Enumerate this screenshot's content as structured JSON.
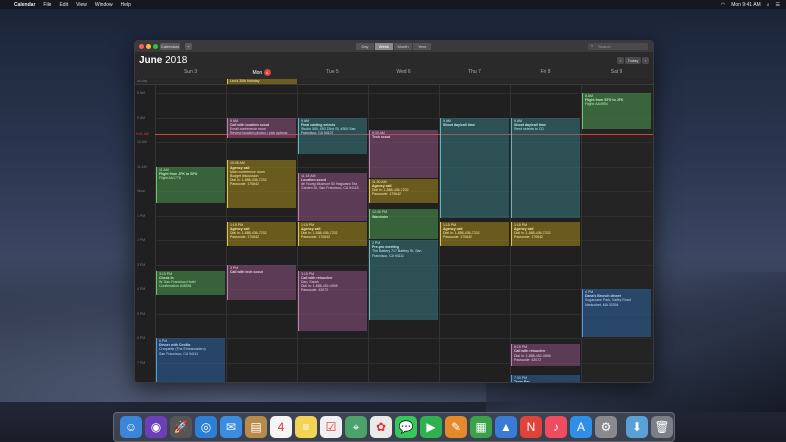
{
  "menubar": {
    "app": "Calendar",
    "items": [
      "File",
      "Edit",
      "View",
      "Window",
      "Help"
    ],
    "clock": "Mon 9:41 AM"
  },
  "toolbar": {
    "calendars_label": "Calendars",
    "add_label": "+",
    "views": [
      "Day",
      "Week",
      "Month",
      "Year"
    ],
    "active_view": "Week",
    "search_placeholder": "Search"
  },
  "header": {
    "month": "June",
    "year": "2018",
    "today_label": "Today",
    "prev": "‹",
    "next": "›"
  },
  "days": [
    {
      "name": "Sun 3"
    },
    {
      "name": "Mon",
      "badge": "4"
    },
    {
      "name": "Tue 5"
    },
    {
      "name": "Wed 6"
    },
    {
      "name": "Thu 7"
    },
    {
      "name": "Fri 8"
    },
    {
      "name": "Sat 9"
    }
  ],
  "allday_event": "Leo's 30th birthday",
  "time_labels": [
    "all-day",
    "8 AM",
    "9 AM",
    "10 AM",
    "11 AM",
    "Noon",
    "1 PM",
    "2 PM",
    "3 PM",
    "4 PM",
    "5 PM",
    "6 PM",
    "7 PM"
  ],
  "now_label": "9:41 AM",
  "events": [
    {
      "day": 0,
      "time": "11 AM",
      "title": "Flight from JFK to SFO",
      "sub": "Flight AA1776",
      "color": "green"
    },
    {
      "day": 0,
      "time": "3:15 PM",
      "title": "Check in",
      "sub": "W. San Francisco Hotel\nConfirmation #48394",
      "color": "green"
    },
    {
      "day": 0,
      "time": "6 PM",
      "title": "Dinner with Cecilia",
      "sub": "Croquette (The Embarcadero)\nSan Francisco, CA 94111",
      "color": "blue"
    },
    {
      "day": 1,
      "time": "9 AM",
      "title": "Call with location scout",
      "sub": "Email conference room\nReview location photos / pick options",
      "color": "purple"
    },
    {
      "day": 1,
      "time": "10:45 AM",
      "title": "Agency call",
      "sub": "Main conference room\nBudget discussion\nDial in: 1-888-436-7232\nPasscode: 170642",
      "color": "yellow"
    },
    {
      "day": 1,
      "time": "1:15 PM",
      "title": "Agency call",
      "sub": "Dial in: 1-888-436-7232\nPasscode: 170642",
      "color": "yellow"
    },
    {
      "day": 1,
      "time": "3 PM",
      "title": "Call with tech scout",
      "sub": "",
      "color": "purple"
    },
    {
      "day": 2,
      "time": "9 AM",
      "title": "Final casting selects",
      "sub": "Studio 300, 450 22nd St, #300 San Francisco, CA 94107",
      "color": "teal"
    },
    {
      "day": 2,
      "time": "11:15 AM",
      "title": "Location scout",
      "sub": "de Young Museum 50 Hagiwara Tea Garden Dr, San Francisco, CA 94118",
      "color": "purple"
    },
    {
      "day": 2,
      "time": "1:15 PM",
      "title": "Agency call",
      "sub": "Dial in: 1-888-436-7232\nPasscode: 170642",
      "color": "yellow"
    },
    {
      "day": 2,
      "time": "3:15 PM",
      "title": "Call with retoucher",
      "sub": "Dan, Sarah\nDial in: 1-888-452-4998\nPasscode: 43072",
      "color": "purple"
    },
    {
      "day": 3,
      "time": "9:30 AM",
      "title": "Tech scout",
      "sub": "",
      "color": "purple"
    },
    {
      "day": 3,
      "time": "11:30 AM",
      "title": "Agency call",
      "sub": "Dial in: 1-888-436-7232\nPasscode: 170642",
      "color": "yellow"
    },
    {
      "day": 3,
      "time": "12:45 PM",
      "title": "Wardrobe",
      "sub": "",
      "color": "green"
    },
    {
      "day": 3,
      "time": "2 PM",
      "title": "Pre-pro meeting",
      "sub": "The Battery 717 Battery St, San Francisco, CA 94111",
      "color": "teal"
    },
    {
      "day": 4,
      "time": "9 AM",
      "title": "Shoot day/call time",
      "sub": "",
      "color": "teal"
    },
    {
      "day": 4,
      "time": "1:15 PM",
      "title": "Agency call",
      "sub": "Dial in: 1-888-436-7232\nPasscode: 170642",
      "color": "yellow"
    },
    {
      "day": 5,
      "time": "9 AM",
      "title": "Shoot day/call time",
      "sub": "Send selects to CD",
      "color": "teal"
    },
    {
      "day": 5,
      "time": "1:15 PM",
      "title": "Agency call",
      "sub": "Dial in: 1-888-436-7232\nPasscode: 170642",
      "color": "yellow"
    },
    {
      "day": 5,
      "time": "6:15 PM",
      "title": "Call with retoucher",
      "sub": "Dial in: 1-888-452-4998\nPasscode: 43072",
      "color": "purple"
    },
    {
      "day": 5,
      "time": "7:30 PM",
      "title": "Team Bar",
      "sub": "",
      "color": "blue"
    },
    {
      "day": 6,
      "time": "8 AM",
      "title": "Flight from SFO to JFK",
      "sub": "Flight: AA4954",
      "color": "green"
    },
    {
      "day": 6,
      "time": "4 PM",
      "title": "Dana's Brunch dinner",
      "sub": "Sugarcane Park, Valley Road\nNantucket, MA 02554",
      "color": "blue"
    }
  ],
  "dock": [
    "Finder",
    "Siri",
    "Launchpad",
    "Safari",
    "Mail",
    "Contacts",
    "Calendar",
    "Notes",
    "Reminders",
    "Maps",
    "Photos",
    "Messages",
    "FaceTime",
    "Pages",
    "Numbers",
    "Keynote",
    "News",
    "Music",
    "App Store",
    "System Preferences",
    "Downloads",
    "Trash"
  ]
}
